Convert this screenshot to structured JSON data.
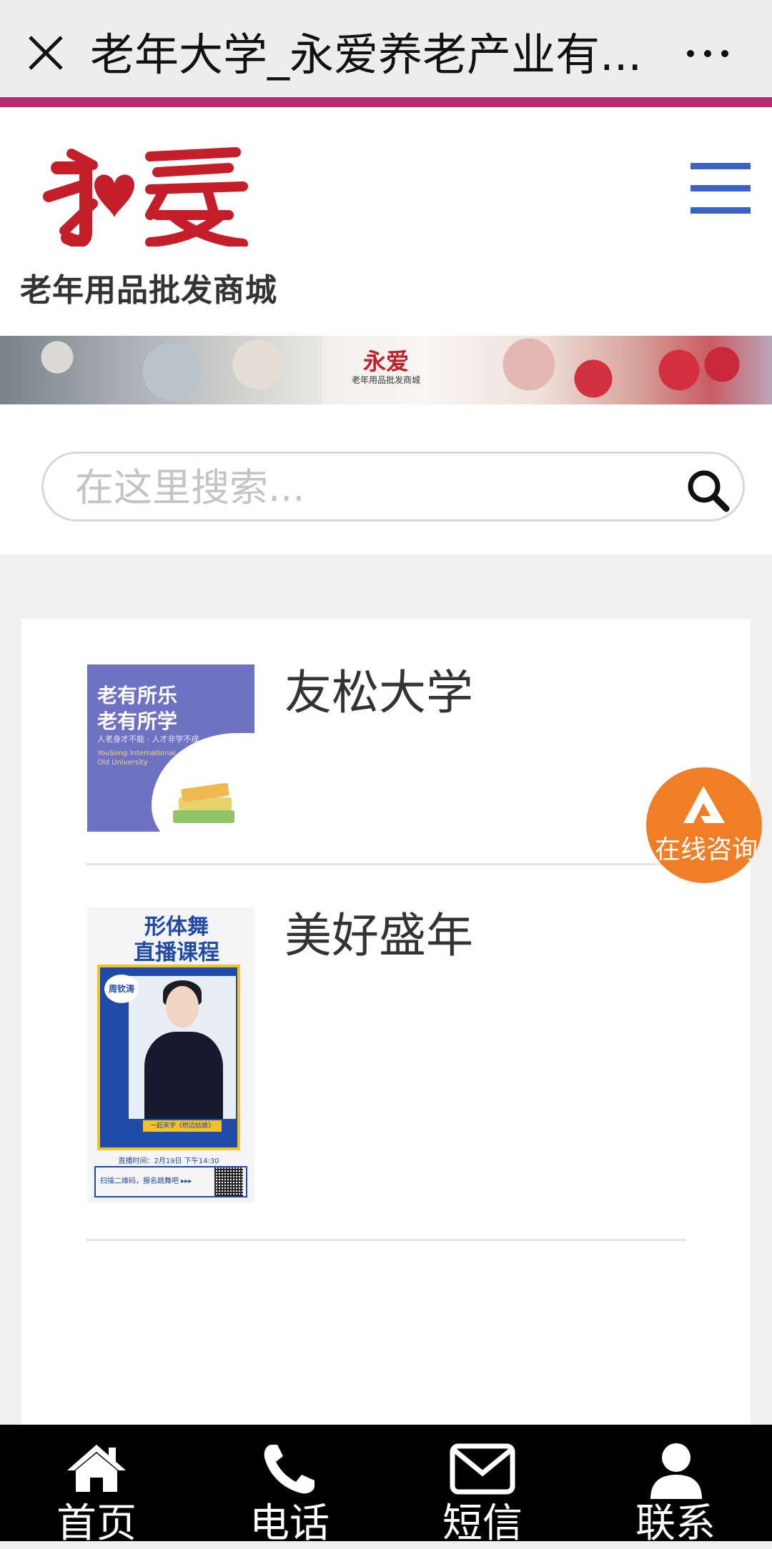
{
  "topbar": {
    "title": "老年大学_永爱养老产业有...",
    "accent_color": "#b5306b"
  },
  "header": {
    "logo_mark": "永爱",
    "logo_subtitle": "老年用品批发商城"
  },
  "banner": {
    "logo_mark": "永爱",
    "logo_subtitle": "老年用品批发商城"
  },
  "search": {
    "placeholder": "在这里搜索...",
    "value": ""
  },
  "items": [
    {
      "title": "友松大学",
      "thumb": {
        "line1": "老有所乐",
        "line2": "老有所学",
        "tagline": "人老身才不能 · 人才非学不成",
        "english1": "YouSong International",
        "english2": "Old University"
      }
    },
    {
      "title": "美好盛年",
      "thumb": {
        "head1": "形体舞",
        "head2": "直播课程",
        "teacher": "周钦涛",
        "tag": "一起来学《桥边姑娘》",
        "time": "直播时间：2月19日 下午14:30",
        "footer": "扫描二维码，报名跳舞吧 ▸▸▸"
      }
    }
  ],
  "consult": {
    "label": "在线咨询",
    "color": "#f07e26"
  },
  "bottom_nav": [
    {
      "label": "首页",
      "icon": "home-icon"
    },
    {
      "label": "电话",
      "icon": "phone-icon"
    },
    {
      "label": "短信",
      "icon": "mail-icon"
    },
    {
      "label": "联系",
      "icon": "user-icon"
    }
  ]
}
